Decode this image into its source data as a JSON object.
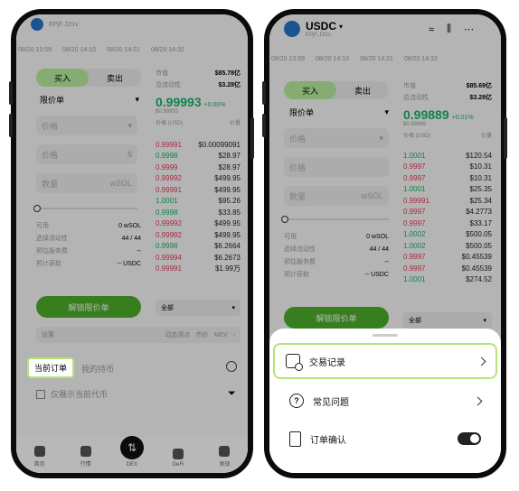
{
  "left": {
    "pair": "EPjF..Dt1v",
    "times": [
      "08/20 13:59",
      "08/20 14:10",
      "08/20 14:21",
      "08/20 14:32"
    ],
    "buy": "买入",
    "sell": "卖出",
    "order_type": "限价单",
    "price_ph": "价格",
    "amount_ph": "数量",
    "unit_price": "$",
    "unit_sol": "wSOL",
    "available_label": "可用",
    "available_value": "0 wSOL",
    "slippage_label": "选择流动性",
    "slippage_value": "44 / 44",
    "fee_label": "预估服务费",
    "fee_value": "--",
    "receive_label": "预计获取",
    "receive_value": "-- USDC",
    "unlock": "解锁限价单",
    "depth": "全部",
    "settings": "设置",
    "dyn_slip": "动态滑点",
    "market": "市价",
    "mev": "MEV",
    "current_orders": "当前订单",
    "holdings": "我的持币",
    "only_current": "仅展示当前代币",
    "mkt_value_label": "市值",
    "mkt_value": "$85.78亿",
    "liq_label": "总流动性",
    "liq_value": "$3.28亿",
    "price": "0.99993",
    "price_change": "+0.00%",
    "price_usd": "$0.99993",
    "col_price": "价格 (USD)",
    "col_amount": "价量",
    "book": [
      {
        "p": "0.99991",
        "a": "$0.00099091",
        "side": "ask"
      },
      {
        "p": "0.9998",
        "a": "$28.97",
        "side": "bid"
      },
      {
        "p": "0.9999",
        "a": "$28.97",
        "side": "ask"
      },
      {
        "p": "0.99992",
        "a": "$499.95",
        "side": "ask"
      },
      {
        "p": "0.99991",
        "a": "$499.95",
        "side": "ask"
      },
      {
        "p": "1.0001",
        "a": "$95.26",
        "side": "bid"
      },
      {
        "p": "0.9998",
        "a": "$33.85",
        "side": "bid"
      },
      {
        "p": "0.99992",
        "a": "$499.95",
        "side": "ask"
      },
      {
        "p": "0.99992",
        "a": "$499.95",
        "side": "ask"
      },
      {
        "p": "0.9998",
        "a": "$6.2664",
        "side": "bid"
      },
      {
        "p": "0.99994",
        "a": "$6.2673",
        "side": "ask"
      },
      {
        "p": "0.99991",
        "a": "$1.99万",
        "side": "ask"
      }
    ],
    "tabs": [
      "首页",
      "行情",
      "DEX",
      "DeFi",
      "发现"
    ]
  },
  "right": {
    "coin": "USDC",
    "pair": "EPjF..Dt1v",
    "times": [
      "08/20 13:59",
      "08/20 14:10",
      "08/20 14:21",
      "08/20 14:32"
    ],
    "buy": "买入",
    "sell": "卖出",
    "order_type": "限价单",
    "price_ph": "价格",
    "amount_ph": "数量",
    "unit_sol": "wSOL",
    "available_label": "可用",
    "available_value": "0 wSOL",
    "slippage_label": "选择流动性",
    "slippage_value": "44 / 44",
    "fee_label": "预估服务费",
    "fee_value": "--",
    "receive_label": "预计获取",
    "receive_value": "-- USDC",
    "unlock": "解锁限价单",
    "depth": "全部",
    "mkt_value_label": "市值",
    "mkt_value": "$85.69亿",
    "liq_label": "总流动性",
    "liq_value": "$3.28亿",
    "price": "0.99889",
    "price_change": "+0.01%",
    "price_usd": "$0.99889",
    "col_price": "价格 (USD)",
    "col_amount": "价量",
    "book": [
      {
        "p": "1.0001",
        "a": "$120.54",
        "side": "bid"
      },
      {
        "p": "0.9997",
        "a": "$10.31",
        "side": "ask"
      },
      {
        "p": "0.9997",
        "a": "$10.31",
        "side": "ask"
      },
      {
        "p": "1.0001",
        "a": "$25.35",
        "side": "bid"
      },
      {
        "p": "0.99991",
        "a": "$25.34",
        "side": "ask"
      },
      {
        "p": "0.9997",
        "a": "$4.2773",
        "side": "ask"
      },
      {
        "p": "0.9997",
        "a": "$33.17",
        "side": "ask"
      },
      {
        "p": "1.0002",
        "a": "$500.05",
        "side": "bid"
      },
      {
        "p": "1.0002",
        "a": "$500.05",
        "side": "bid"
      },
      {
        "p": "0.9997",
        "a": "$0.45539",
        "side": "ask"
      },
      {
        "p": "0.9997",
        "a": "$0.45539",
        "side": "ask"
      },
      {
        "p": "1.0001",
        "a": "$274.52",
        "side": "bid"
      }
    ],
    "sheet": {
      "trade_history": "交易记录",
      "faq": "常见问题",
      "order_confirm": "订单确认"
    }
  }
}
